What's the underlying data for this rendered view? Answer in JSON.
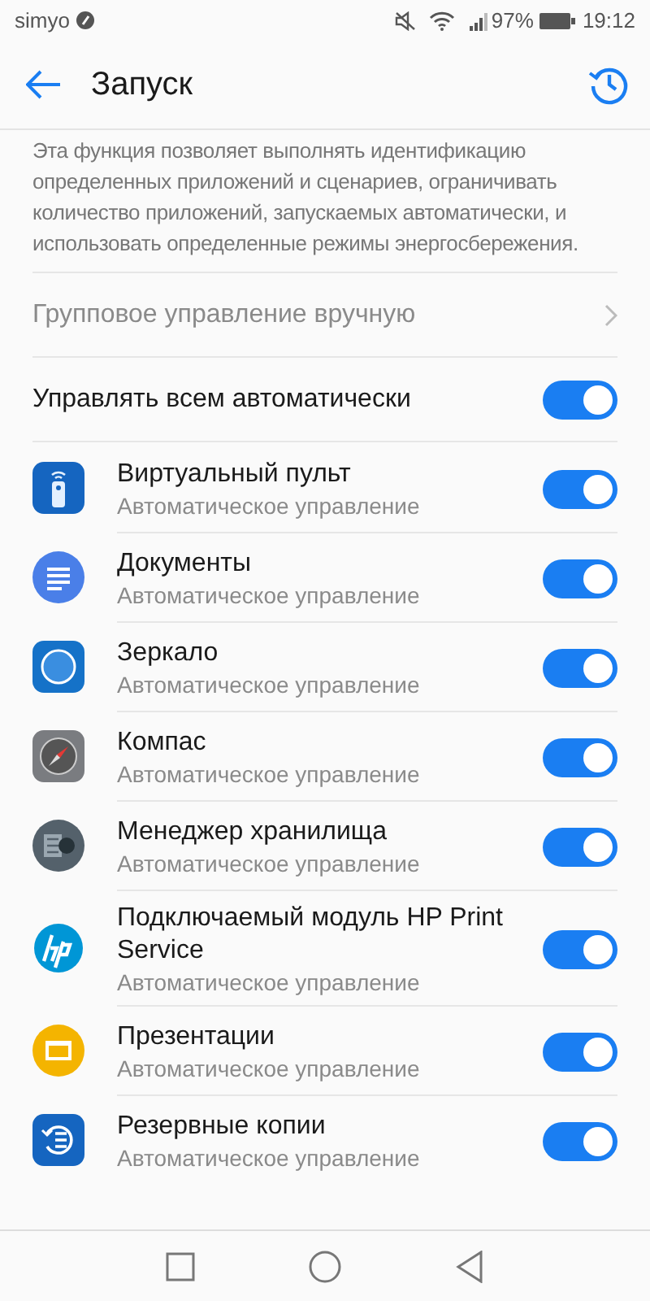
{
  "status_bar": {
    "carrier": "simyo",
    "battery": "97%",
    "time": "19:12"
  },
  "app_bar": {
    "title": "Запуск"
  },
  "description": "Эта функция позволяет выполнять идентификацию определенных приложений и сценариев, ограничивать количество приложений, запускаемых автоматически, и использовать определенные режимы энергосбережения.",
  "manual_group": {
    "label": "Групповое управление вручную",
    "disabled": true
  },
  "manage_all": {
    "label": "Управлять всем автоматически",
    "on": true
  },
  "apps": [
    {
      "name": "Виртуальный пульт",
      "status": "Автоматическое управление",
      "on": true
    },
    {
      "name": "Документы",
      "status": "Автоматическое управление",
      "on": true
    },
    {
      "name": "Зеркало",
      "status": "Автоматическое управление",
      "on": true
    },
    {
      "name": "Компас",
      "status": "Автоматическое управление",
      "on": true
    },
    {
      "name": "Менеджер хранилища",
      "status": "Автоматическое управление",
      "on": true
    },
    {
      "name": "Подключаемый модуль HP Print Service",
      "status": "Автоматическое управление",
      "on": true
    },
    {
      "name": "Презентации",
      "status": "Автоматическое управление",
      "on": true
    },
    {
      "name": "Резервные копии",
      "status": "Автоматическое управление",
      "on": true
    }
  ]
}
